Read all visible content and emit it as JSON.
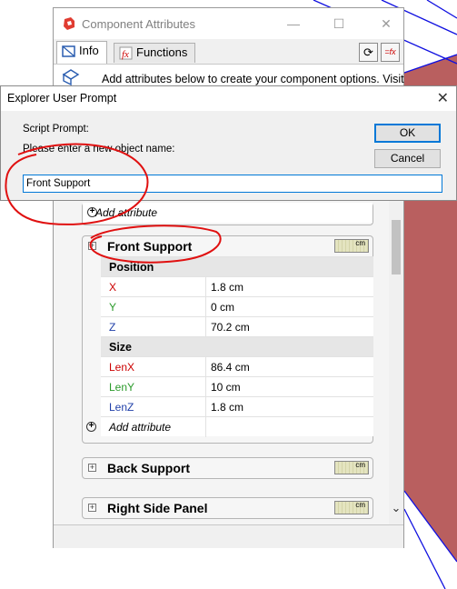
{
  "component_attributes": {
    "window_title": "Component Attributes",
    "minimize_glyph": "—",
    "maximize_glyph": "☐",
    "close_glyph": "✕",
    "tabs": [
      {
        "label": "Info",
        "icon": "info-tab-icon"
      },
      {
        "label": "Functions",
        "icon": "functions-tab-icon"
      }
    ],
    "refresh_glyph": "⟳",
    "function_glyph": "=fx",
    "info_text": "Add attributes below to create your component options. Visit",
    "add_attribute_label": "Add attribute",
    "panels": [
      {
        "title": "Front Support",
        "unit": "cm",
        "groups": [
          {
            "name": "Position",
            "rows": [
              {
                "label": "X",
                "value": "1.8 cm",
                "color": "#cc0000"
              },
              {
                "label": "Y",
                "value": "0 cm",
                "color": "#2a9a2a"
              },
              {
                "label": "Z",
                "value": "70.2 cm",
                "color": "#1f3fa8"
              }
            ]
          },
          {
            "name": "Size",
            "rows": [
              {
                "label": "LenX",
                "value": "86.4 cm",
                "color": "#cc0000"
              },
              {
                "label": "LenY",
                "value": "10 cm",
                "color": "#2a9a2a"
              },
              {
                "label": "LenZ",
                "value": "1.8 cm",
                "color": "#1f3fa8"
              }
            ]
          }
        ]
      },
      {
        "title": "Back Support",
        "unit": "cm"
      },
      {
        "title": "Right Side Panel",
        "unit": "cm"
      }
    ],
    "expander_glyph": "+",
    "add_glyph": "+",
    "scroll_down_glyph": "⌄"
  },
  "prompt_dialog": {
    "title": "Explorer User Prompt",
    "close_glyph": "✕",
    "script_prompt_label": "Script Prompt:",
    "instruction": "Please enter a new object name:",
    "input_value": "Front Support",
    "ok_label": "OK",
    "cancel_label": "Cancel"
  },
  "colors": {
    "accent": "#0078d7",
    "annotation": "#e01010",
    "viewport_face": "#b95f5f",
    "viewport_edge": "#1010e0"
  }
}
